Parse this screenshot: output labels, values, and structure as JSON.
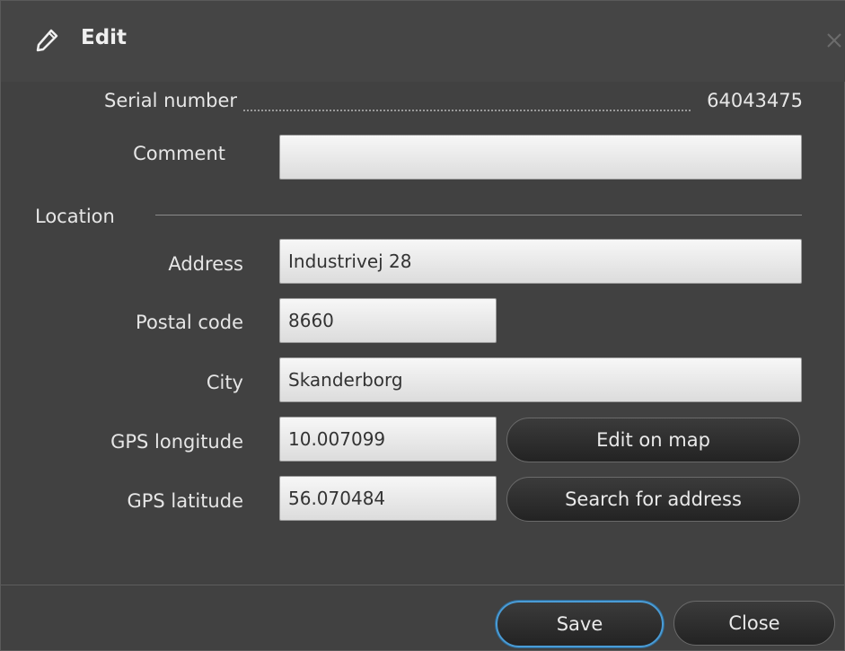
{
  "dialog": {
    "title": "Edit",
    "icon": "pencil-icon",
    "close_icon": "close-icon"
  },
  "serial": {
    "label": "Serial number",
    "value": "64043475"
  },
  "comment": {
    "label": "Comment",
    "value": ""
  },
  "location": {
    "section_label": "Location",
    "address": {
      "label": "Address",
      "value": "Industrivej 28"
    },
    "postal_code": {
      "label": "Postal code",
      "value": "8660"
    },
    "city": {
      "label": "City",
      "value": "Skanderborg"
    },
    "gps_longitude": {
      "label": "GPS longitude",
      "value": "10.007099"
    },
    "gps_latitude": {
      "label": "GPS latitude",
      "value": "56.070484"
    },
    "edit_on_map_label": "Edit on map",
    "search_address_label": "Search for address"
  },
  "footer": {
    "save_label": "Save",
    "close_label": "Close"
  },
  "colors": {
    "background": "#414141",
    "focus_ring": "#4a9cd6"
  }
}
